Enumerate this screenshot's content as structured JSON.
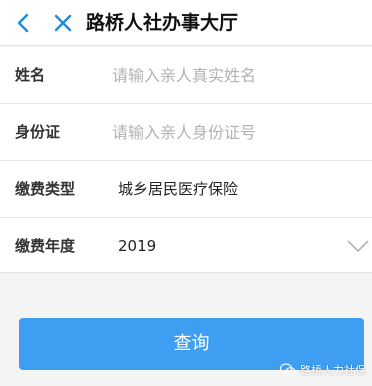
{
  "header": {
    "title": "路桥人社办事大厅",
    "back_icon": "chevron-left-icon",
    "close_icon": "close-icon",
    "accent_color": "#1a8ce0"
  },
  "form": {
    "name": {
      "label": "姓名",
      "placeholder": "请输入亲人真实姓名",
      "value": ""
    },
    "id_number": {
      "label": "身份证",
      "placeholder": "请输入亲人身份证号",
      "value": ""
    },
    "payment_type": {
      "label": "缴费类型",
      "value": "城乡居民医疗保险"
    },
    "payment_year": {
      "label": "缴费年度",
      "value": "2019",
      "dropdown_icon": "chevron-down-icon"
    }
  },
  "query_button": {
    "label": "查询",
    "color": "#3d9ef2"
  },
  "watermark": {
    "text": "路桥人力社保",
    "icon": "wechat-icon"
  }
}
